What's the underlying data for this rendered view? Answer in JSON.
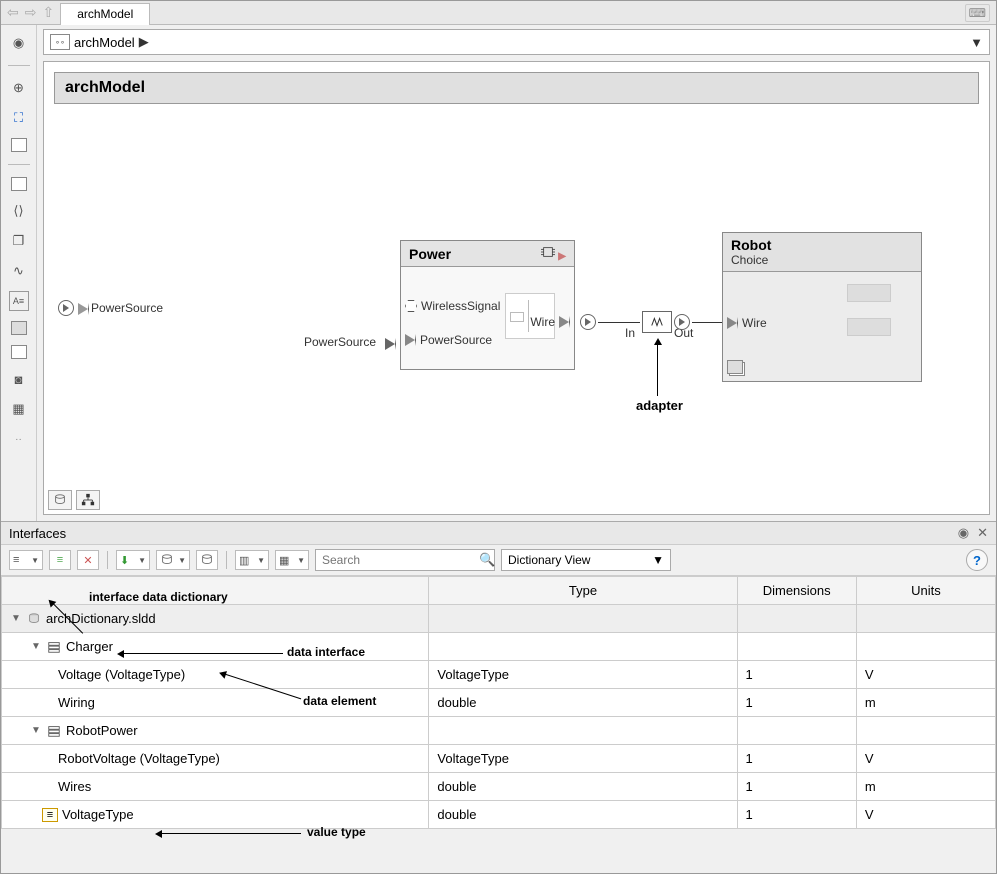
{
  "tab": {
    "name": "archModel"
  },
  "breadcrumb": {
    "name": "archModel"
  },
  "model": {
    "title": "archModel",
    "rootport": "PowerSource",
    "powersource_label": "PowerSource",
    "power_block": {
      "title": "Power",
      "port_wireless": "WirelessSignal",
      "port_powersource": "PowerSource",
      "port_wire": "Wire"
    },
    "adapter": {
      "in": "In",
      "out": "Out"
    },
    "robot_block": {
      "title": "Robot",
      "subtitle": "Choice",
      "port_wire": "Wire"
    },
    "annotation_adapter": "adapter"
  },
  "interfaces": {
    "title": "Interfaces",
    "search_placeholder": "Search",
    "view_select": "Dictionary View",
    "columns": {
      "name": "",
      "type": "Type",
      "dims": "Dimensions",
      "units": "Units"
    },
    "rows": [
      {
        "name": "archDictionary.sldd",
        "type": "",
        "dims": "",
        "units": "",
        "kind": "dict"
      },
      {
        "name": "Charger",
        "type": "",
        "dims": "",
        "units": "",
        "kind": "iface"
      },
      {
        "name": "Voltage (VoltageType)",
        "type": "VoltageType",
        "dims": "1",
        "units": "V",
        "kind": "elem"
      },
      {
        "name": "Wiring",
        "type": "double",
        "dims": "1",
        "units": "m",
        "kind": "elem"
      },
      {
        "name": "RobotPower",
        "type": "",
        "dims": "",
        "units": "",
        "kind": "iface"
      },
      {
        "name": "RobotVoltage (VoltageType)",
        "type": "VoltageType",
        "dims": "1",
        "units": "V",
        "kind": "elem"
      },
      {
        "name": "Wires",
        "type": "double",
        "dims": "1",
        "units": "m",
        "kind": "elem"
      },
      {
        "name": "VoltageType",
        "type": "double",
        "dims": "1",
        "units": "V",
        "kind": "vtype"
      }
    ],
    "annotations": {
      "dict": "interface data dictionary",
      "iface": "data interface",
      "elem": "data element",
      "vtype": "value type"
    }
  }
}
